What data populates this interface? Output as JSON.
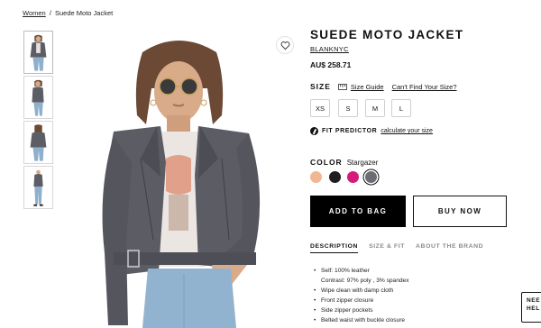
{
  "breadcrumb": {
    "parent": "Women",
    "separator": "/",
    "current": "Suede Moto Jacket"
  },
  "product": {
    "title": "SUEDE MOTO JACKET",
    "brand": "BLANKNYC",
    "price": "AU$ 258.71"
  },
  "size": {
    "label": "SIZE",
    "guide_link": "Size Guide",
    "cant_find_link": "Can't Find Your Size?",
    "options": [
      "XS",
      "S",
      "M",
      "L"
    ]
  },
  "fit_predictor": {
    "label": "FIT PREDICTOR",
    "link": "calculate your size"
  },
  "color": {
    "label": "COLOR",
    "selected_name": "Stargazer",
    "swatches": [
      "#f1b792",
      "#1e1e1e",
      "#d6197b",
      "#6c6c73"
    ],
    "selected_index": 3
  },
  "actions": {
    "add_to_bag": "ADD TO BAG",
    "buy_now": "BUY NOW"
  },
  "tabs": [
    "DESCRIPTION",
    "SIZE & FIT",
    "ABOUT THE BRAND"
  ],
  "details": [
    {
      "text": "Self: 100% leather",
      "sub": "Contrast: 97% poly , 3% spandex"
    },
    {
      "text": "Wipe clean with damp cloth"
    },
    {
      "text": "Front zipper closure"
    },
    {
      "text": "Side zipper pockets"
    },
    {
      "text": "Belted waist with buckle closure"
    }
  ],
  "help_chat": {
    "line1": "NEE",
    "line2": "HEL"
  }
}
